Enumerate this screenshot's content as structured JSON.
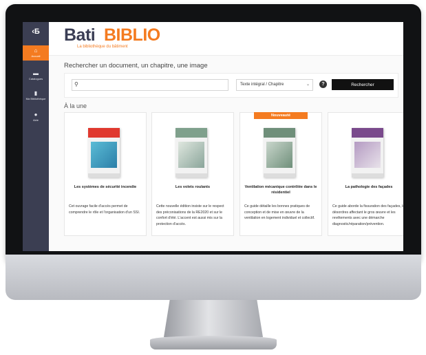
{
  "sidebar": {
    "logo": "‹Б",
    "items": [
      {
        "label": "Accueil",
        "icon": "home-icon",
        "glyph": "⌂"
      },
      {
        "label": "Catalogues",
        "icon": "folder-icon",
        "glyph": "▬"
      },
      {
        "label": "Ma Bibliothèque",
        "icon": "bookmark-icon",
        "glyph": "▮"
      },
      {
        "label": "Aide",
        "icon": "help-icon",
        "glyph": "●"
      }
    ]
  },
  "header": {
    "logo_bati": "Bati",
    "logo_biblio": "BIBLIO",
    "tagline": "La bibliothèque du bâtiment"
  },
  "search": {
    "heading": "Rechercher un document, un chapitre, une image",
    "placeholder": "",
    "mode": "Texte intégral / Chapitre",
    "help_glyph": "?",
    "button": "Rechercher"
  },
  "featured": {
    "heading": "À la une",
    "items": [
      {
        "badge": "",
        "title": "Les systèmes de sécurité incendie",
        "description": "Cet ouvrage facile d'accès permet de comprendre le rôle et l'organisation d'un SSI.",
        "cover_color": "#e0392f"
      },
      {
        "badge": "",
        "title": "Les volets roulants",
        "description": "Cette nouvelle édition insiste sur le respect des préconisations de la RE2020 et sur le confort d'été. L'accent est aussi mis sur la protection d'accès.",
        "cover_color": "#7fa08c"
      },
      {
        "badge": "Nouveauté",
        "title": "Ventilation mécanique contrôlée dans le résidentiel",
        "description": "Ce guide détaille les bonnes pratiques de conception et de mise en œuvre de la ventilation en logement individuel et collectif.",
        "cover_color": "#6f8f7a"
      },
      {
        "badge": "",
        "title": "La pathologie des façades",
        "description": "Ce guide aborde la fissuration des façades, les désordres affectant le gros œuvre et les revêtements avec une démarche diagnostic/réparation/prévention.",
        "cover_color": "#7a4a8c"
      }
    ]
  }
}
